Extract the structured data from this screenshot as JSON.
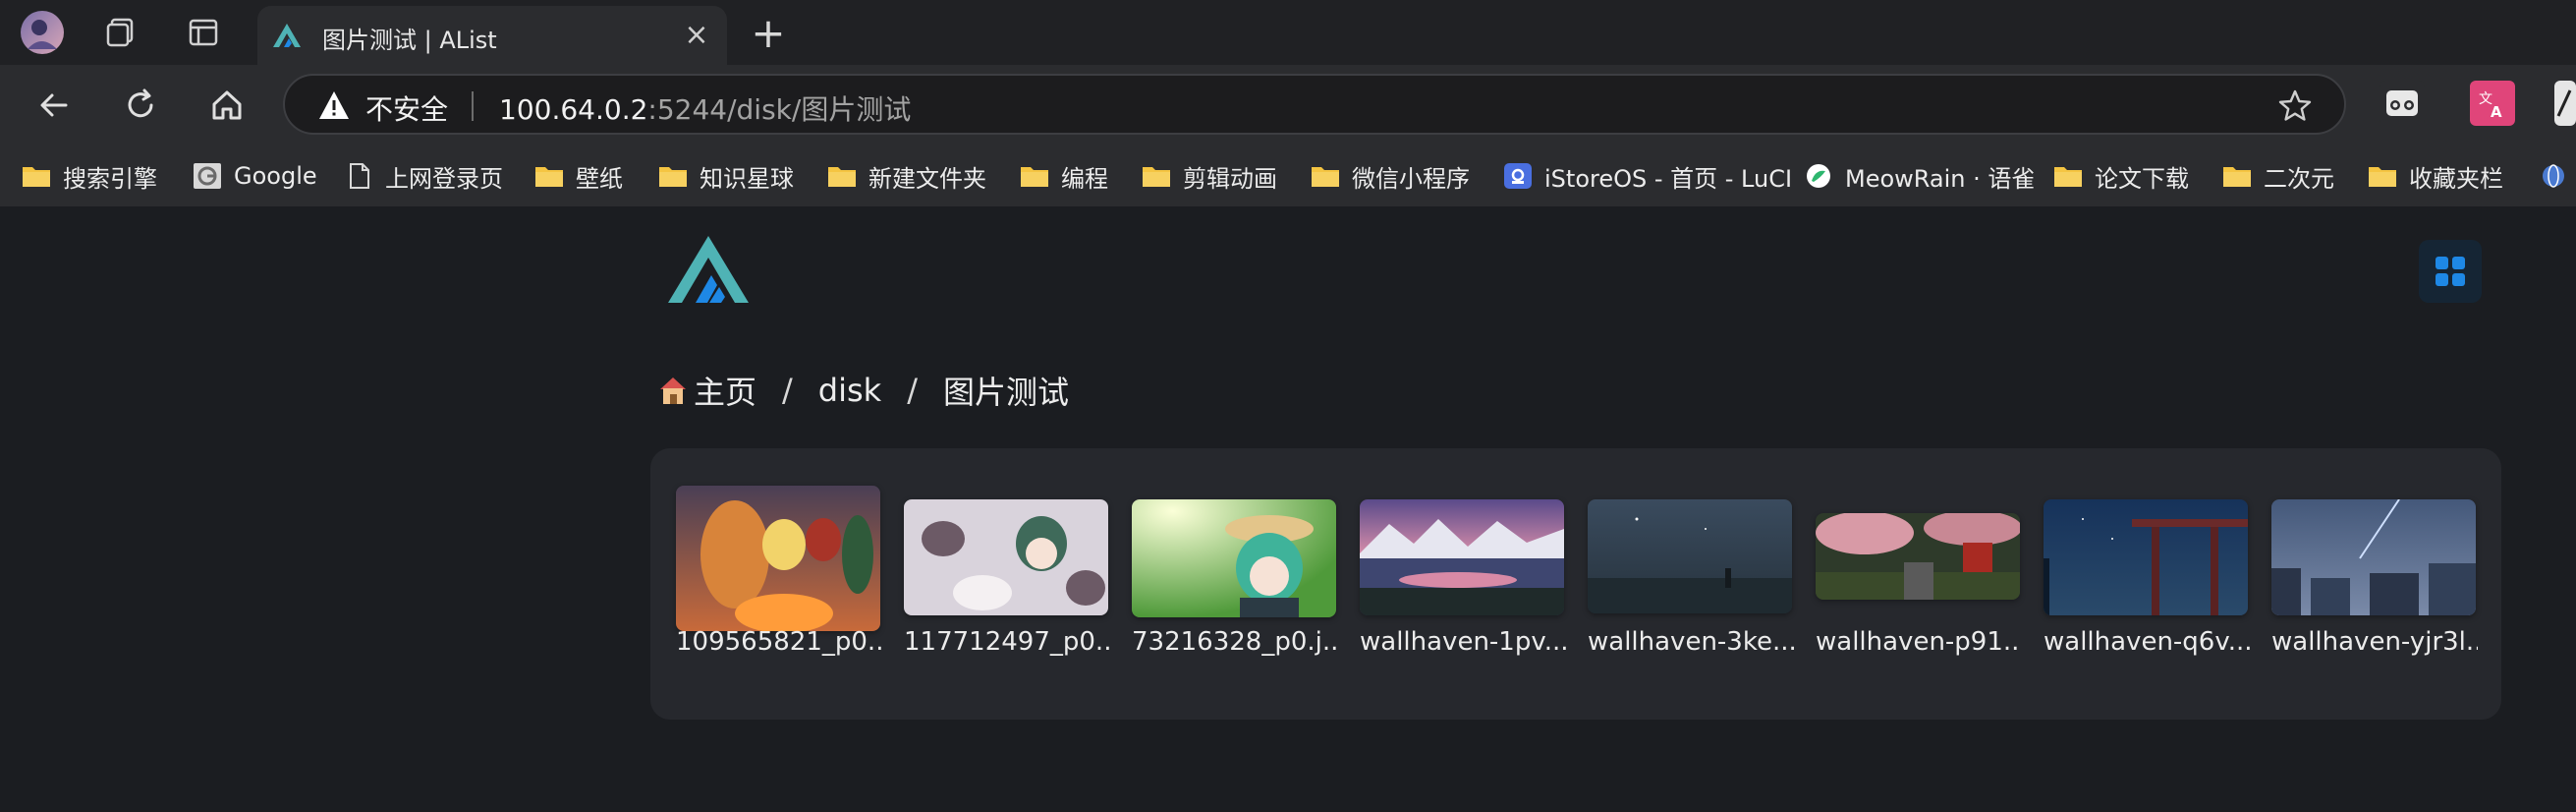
{
  "browser": {
    "tab": {
      "title": "图片测试 | AList",
      "close_glyph": "×"
    },
    "new_tab_glyph": "+",
    "address": {
      "security_label": "不安全",
      "url_host": "100.64.0.2",
      "url_rest": ":5244/disk/图片测试"
    },
    "bookmarks": [
      {
        "label": "搜索引擎",
        "icon": "folder-icon"
      },
      {
        "label": "Google",
        "icon": "google-favicon-icon"
      },
      {
        "label": "上网登录页",
        "icon": "page-icon"
      },
      {
        "label": "壁纸",
        "icon": "folder-icon"
      },
      {
        "label": "知识星球",
        "icon": "folder-icon"
      },
      {
        "label": "新建文件夹",
        "icon": "folder-icon"
      },
      {
        "label": "编程",
        "icon": "folder-icon"
      },
      {
        "label": "剪辑动画",
        "icon": "folder-icon"
      },
      {
        "label": "微信小程序",
        "icon": "folder-icon"
      },
      {
        "label": "iStoreOS - 首页 - LuCI",
        "icon": "istore-favicon-icon"
      },
      {
        "label": "MeowRain · 语雀",
        "icon": "yuque-favicon-icon"
      },
      {
        "label": "论文下载",
        "icon": "folder-icon"
      },
      {
        "label": "二次元",
        "icon": "folder-icon"
      },
      {
        "label": "收藏夹栏",
        "icon": "folder-icon"
      }
    ]
  },
  "alist": {
    "breadcrumb": [
      "主页",
      "disk",
      "图片测试"
    ],
    "breadcrumb_separator": "/",
    "files": [
      {
        "name": "109565821_p0...."
      },
      {
        "name": "117712497_p0...."
      },
      {
        "name": "73216328_p0.j..."
      },
      {
        "name": "wallhaven-1pv..."
      },
      {
        "name": "wallhaven-3ke..."
      },
      {
        "name": "wallhaven-p91..."
      },
      {
        "name": "wallhaven-q6v..."
      },
      {
        "name": "wallhaven-yjr3l..."
      }
    ]
  },
  "colors": {
    "accent": "#1e88e5",
    "logo_teal": "#4fb3b5",
    "logo_blue": "#1e88e5",
    "warning": "#ffffff"
  }
}
